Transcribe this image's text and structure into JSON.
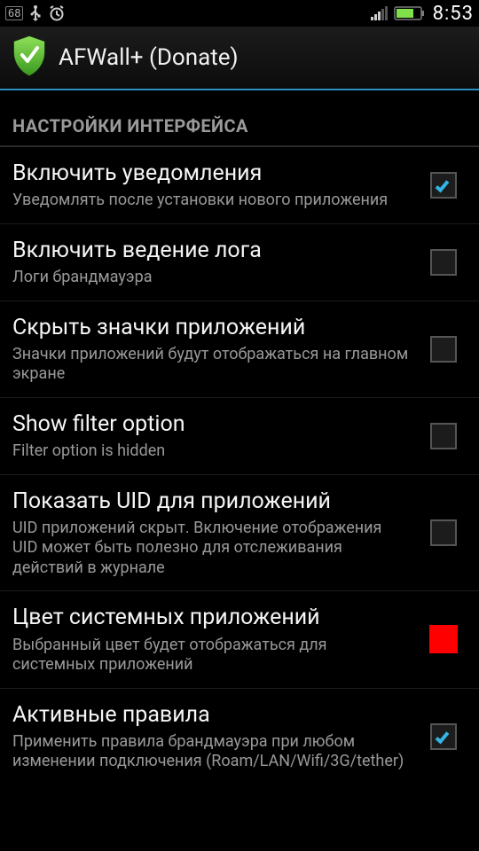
{
  "statusbar": {
    "battery_pct": "68",
    "time": "8:53"
  },
  "actionbar": {
    "title": "AFWall+ (Donate)"
  },
  "section_header": "НАСТРОЙКИ ИНТЕРФЕЙСА",
  "items": [
    {
      "title": "Включить уведомления",
      "subtitle": "Уведомлять после установки нового приложения",
      "checked": true,
      "type": "checkbox"
    },
    {
      "title": "Включить ведение лога",
      "subtitle": "Логи брандмауэра",
      "checked": false,
      "type": "checkbox"
    },
    {
      "title": "Скрыть значки приложений",
      "subtitle": "Значки приложений будут отображаться на главном экране",
      "checked": false,
      "type": "checkbox"
    },
    {
      "title": "Show filter option",
      "subtitle": "Filter option is hidden",
      "checked": false,
      "type": "checkbox"
    },
    {
      "title": "Показать UID для приложений",
      "subtitle": "UID приложений скрыт. Включение отображения UID может быть полезно для отслеживания действий в журнале",
      "checked": false,
      "type": "checkbox"
    },
    {
      "title": "Цвет системных приложений",
      "subtitle": "Выбранный цвет будет отображаться для системных приложений",
      "color": "#ff0000",
      "type": "color"
    },
    {
      "title": "Активные правила",
      "subtitle": "Применить правила брандмауэра при любом изменении подключения (Roam/LAN/Wifi/3G/tether)",
      "checked": true,
      "type": "checkbox"
    }
  ]
}
